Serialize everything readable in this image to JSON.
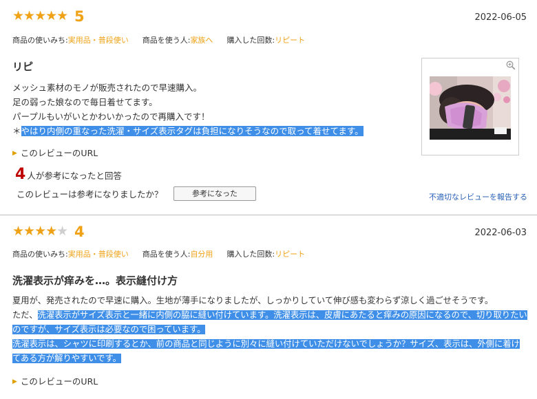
{
  "reviews": [
    {
      "stars": "★★★★★",
      "empty_stars": "",
      "score": "5",
      "date": "2022-06-05",
      "meta": {
        "usage_label": "商品の使いみち:",
        "usage_value": "実用品・普段使い",
        "user_label": "商品を使う人:",
        "user_value": "家族へ",
        "count_label": "購入した回数:",
        "count_value": "リピート"
      },
      "title": "リピ",
      "body": {
        "line1": "メッシュ素材のモノが販売されたので早速購入。",
        "line2": "足の弱った娘なので毎日着せてます。",
        "line3": "パープルもいがいとかわいかったので再購入です！",
        "line4_prefix": "＊",
        "line4_highlight": "やはり内側の重なった洗濯・サイズ表示タグは負担になりそうなので取って着せてます。"
      },
      "url_link": "このレビューのURL",
      "helpful": {
        "count": "4",
        "text": "人が参考になったと回答",
        "question": "このレビューは参考になりましたか？",
        "button": "参考になった",
        "report": "不適切なレビューを報告する"
      },
      "image_alt": "マスクを着用した子どもの写真"
    },
    {
      "stars": "★★★★",
      "empty_stars": "★",
      "score": "4",
      "date": "2022-06-03",
      "meta": {
        "usage_label": "商品の使いみち:",
        "usage_value": "実用品・普段使い",
        "user_label": "商品を使う人:",
        "user_value": "自分用",
        "count_label": "購入した回数:",
        "count_value": "リピート"
      },
      "title": "洗濯表示が痒みを…。表示縫付け方",
      "body": {
        "line1": "夏用が、発売されたので早速に購入。生地が薄手になりましたが、しっかりしていて伸び感も変わらず涼しく過ごせそうです。",
        "line2_prefix": "ただ、",
        "line2_highlight": "洗濯表示がサイズ表示と一緒に内側の脇に縫い付けています。洗濯表示は、皮膚にあたると痒みの原因になるので、切り取りたいのですが、サイズ表示は必要なので困っています。",
        "line3_highlight": "洗濯表示は、シャツに印刷するとか、前の商品と同じように別々に縫い付けていただけないでしょうか？サイズ、表示は、外側に着けてある方が解りやすいです。"
      },
      "url_link": "このレビューのURL"
    }
  ],
  "colors": {
    "star": "#f0a216",
    "highlight": "#3f8fe8",
    "helpful_count": "#bf0000",
    "report_link": "#2961b7"
  }
}
